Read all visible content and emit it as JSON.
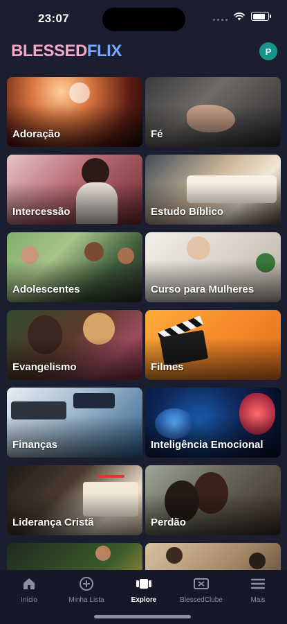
{
  "status": {
    "time": "23:07"
  },
  "header": {
    "logo_part1": "BLESSED",
    "logo_part2": "FLIX",
    "avatar_initial": "P"
  },
  "categories": [
    {
      "label": "Adoração"
    },
    {
      "label": "Fé"
    },
    {
      "label": "Intercessão"
    },
    {
      "label": "Estudo Bíblico"
    },
    {
      "label": "Adolescentes"
    },
    {
      "label": "Curso para Mulheres"
    },
    {
      "label": "Evangelismo"
    },
    {
      "label": "Filmes"
    },
    {
      "label": "Finanças"
    },
    {
      "label": "Inteligência Emocional"
    },
    {
      "label": "Liderança Cristã"
    },
    {
      "label": "Perdão"
    }
  ],
  "nav": {
    "items": [
      {
        "label": "Início",
        "icon": "home-icon"
      },
      {
        "label": "Minha Lista",
        "icon": "plus-circle-icon"
      },
      {
        "label": "Explore",
        "icon": "explore-icon",
        "active": true
      },
      {
        "label": "BlessedClube",
        "icon": "ticket-icon"
      },
      {
        "label": "Mais",
        "icon": "menu-icon"
      }
    ]
  },
  "colors": {
    "background": "#1b1e2e",
    "nav_bg": "#161827",
    "avatar": "#14968b",
    "logo_pink": "#f4a8c8",
    "logo_blue": "#7aa8ff"
  }
}
